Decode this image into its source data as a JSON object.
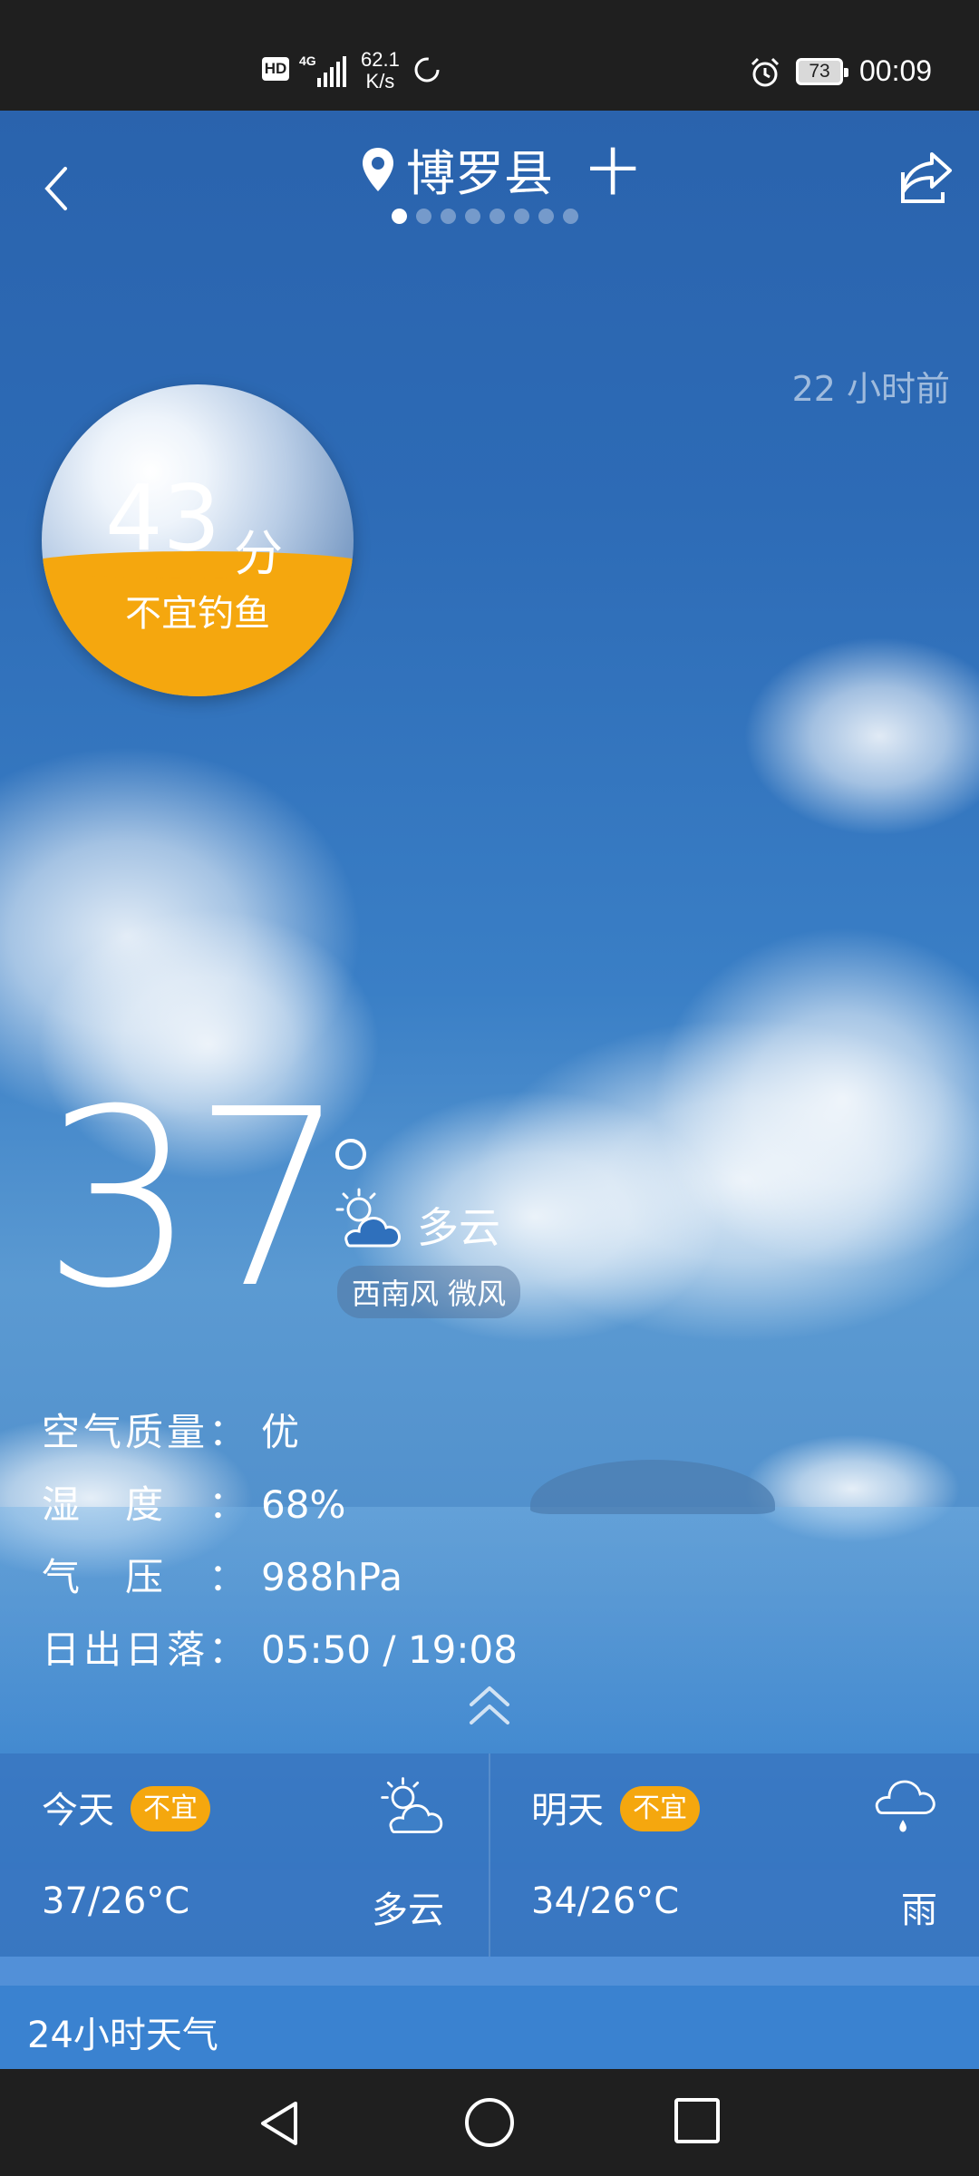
{
  "status_bar": {
    "hd": "HD",
    "network": "4G",
    "speed_value": "62.1",
    "speed_unit": "K/s",
    "battery": "73",
    "time": "00:09"
  },
  "header": {
    "city": "博罗县",
    "add": "十",
    "page_count": 8,
    "active_page": 0
  },
  "updated": "22 小时前",
  "fishing": {
    "score": "43",
    "unit": "分",
    "verdict": "不宜钓鱼",
    "level_fraction": 0.43,
    "fill_color": "#f5a70e"
  },
  "current": {
    "temperature": "37",
    "condition": "多云",
    "condition_icon": "partly-cloudy-icon",
    "wind": "西南风 微风"
  },
  "details": [
    {
      "key": "空气质量",
      "value": "优"
    },
    {
      "key": "湿度",
      "value": "68%"
    },
    {
      "key": "气压",
      "value": "988hPa"
    },
    {
      "key": "日出日落",
      "value": "05:50 / 19:08"
    }
  ],
  "forecast": [
    {
      "day": "今天",
      "badge": "不宜",
      "temp": "37/26°C",
      "condition": "多云",
      "icon": "partly-cloudy-icon"
    },
    {
      "day": "明天",
      "badge": "不宜",
      "temp": "34/26°C",
      "condition": "雨",
      "icon": "rain-icon"
    }
  ],
  "hourly_title": "24小时天气",
  "colors": {
    "accent": "#f5a70e",
    "sky": "#2d6bb6"
  }
}
